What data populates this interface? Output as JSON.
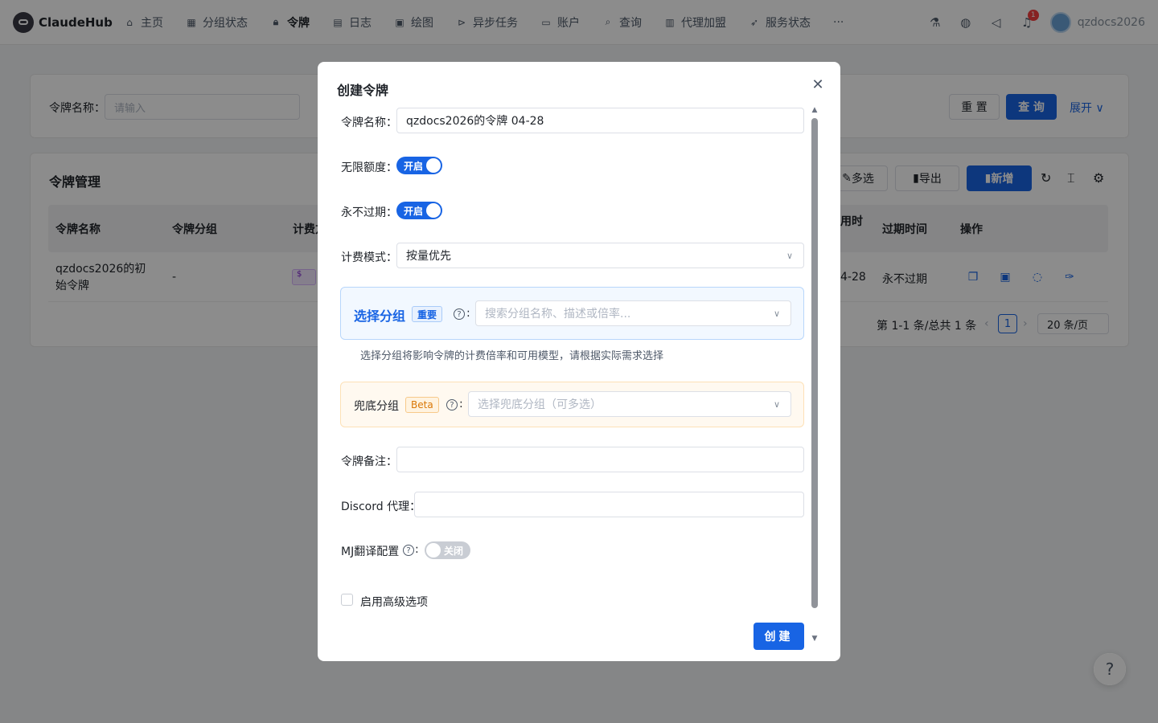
{
  "nav": {
    "brand": "ClaudeHub",
    "items": [
      {
        "label": "主页",
        "icon": "home-icon"
      },
      {
        "label": "分组状态",
        "icon": "grid-icon"
      },
      {
        "label": "令牌",
        "icon": "lock-icon",
        "active": true
      },
      {
        "label": "日志",
        "icon": "document-icon"
      },
      {
        "label": "绘图",
        "icon": "image-icon"
      },
      {
        "label": "异步任务",
        "icon": "play-circle-icon"
      },
      {
        "label": "账户",
        "icon": "card-icon"
      },
      {
        "label": "查询",
        "icon": "search-icon"
      },
      {
        "label": "代理加盟",
        "icon": "store-icon"
      },
      {
        "label": "服务状态",
        "icon": "rocket-icon"
      }
    ],
    "more": "···",
    "notification_count": "1",
    "username": "qzdocs2026"
  },
  "search": {
    "label": "令牌名称：",
    "placeholder": "请输入",
    "reset": "重 置",
    "query": "查 询",
    "expand": "展开"
  },
  "table": {
    "title": "令牌管理",
    "toolbar": {
      "multi_select": "多选",
      "export": "导出",
      "add": "新增"
    },
    "headers": [
      "令牌名称",
      "令牌分组",
      "计费方",
      "用时",
      "过期时间",
      "操作"
    ],
    "row": {
      "name": "qzdocs2026的初始令牌",
      "group": "-",
      "date_partial": "4-28",
      "expire": "永不过期"
    },
    "pagination": {
      "summary": "第 1-1 条/总共 1 条",
      "page": "1",
      "page_size": "20 条/页"
    }
  },
  "modal": {
    "title": "创建令牌",
    "name_label": "令牌名称：",
    "name_value": "qzdocs2026的令牌 04-28",
    "unlimited_label": "无限额度：",
    "unlimited_state": "开启",
    "never_expire_label": "永不过期：",
    "never_expire_state": "开启",
    "billing_label": "计费模式：",
    "billing_value": "按量优先",
    "group_label": "选择分组",
    "group_tag": "重要",
    "group_placeholder": "搜索分组名称、描述或倍率...",
    "group_hint": "选择分组将影响令牌的计费倍率和可用模型，请根据实际需求选择",
    "fallback_label": "兜底分组",
    "fallback_tag": "Beta",
    "fallback_placeholder": "选择兜底分组（可多选）",
    "remark_label": "令牌备注：",
    "discord_label": "Discord 代理：",
    "mj_label": "MJ翻译配置",
    "mj_state": "关闭",
    "advanced_label": "启用高级选项",
    "create": "创建"
  }
}
